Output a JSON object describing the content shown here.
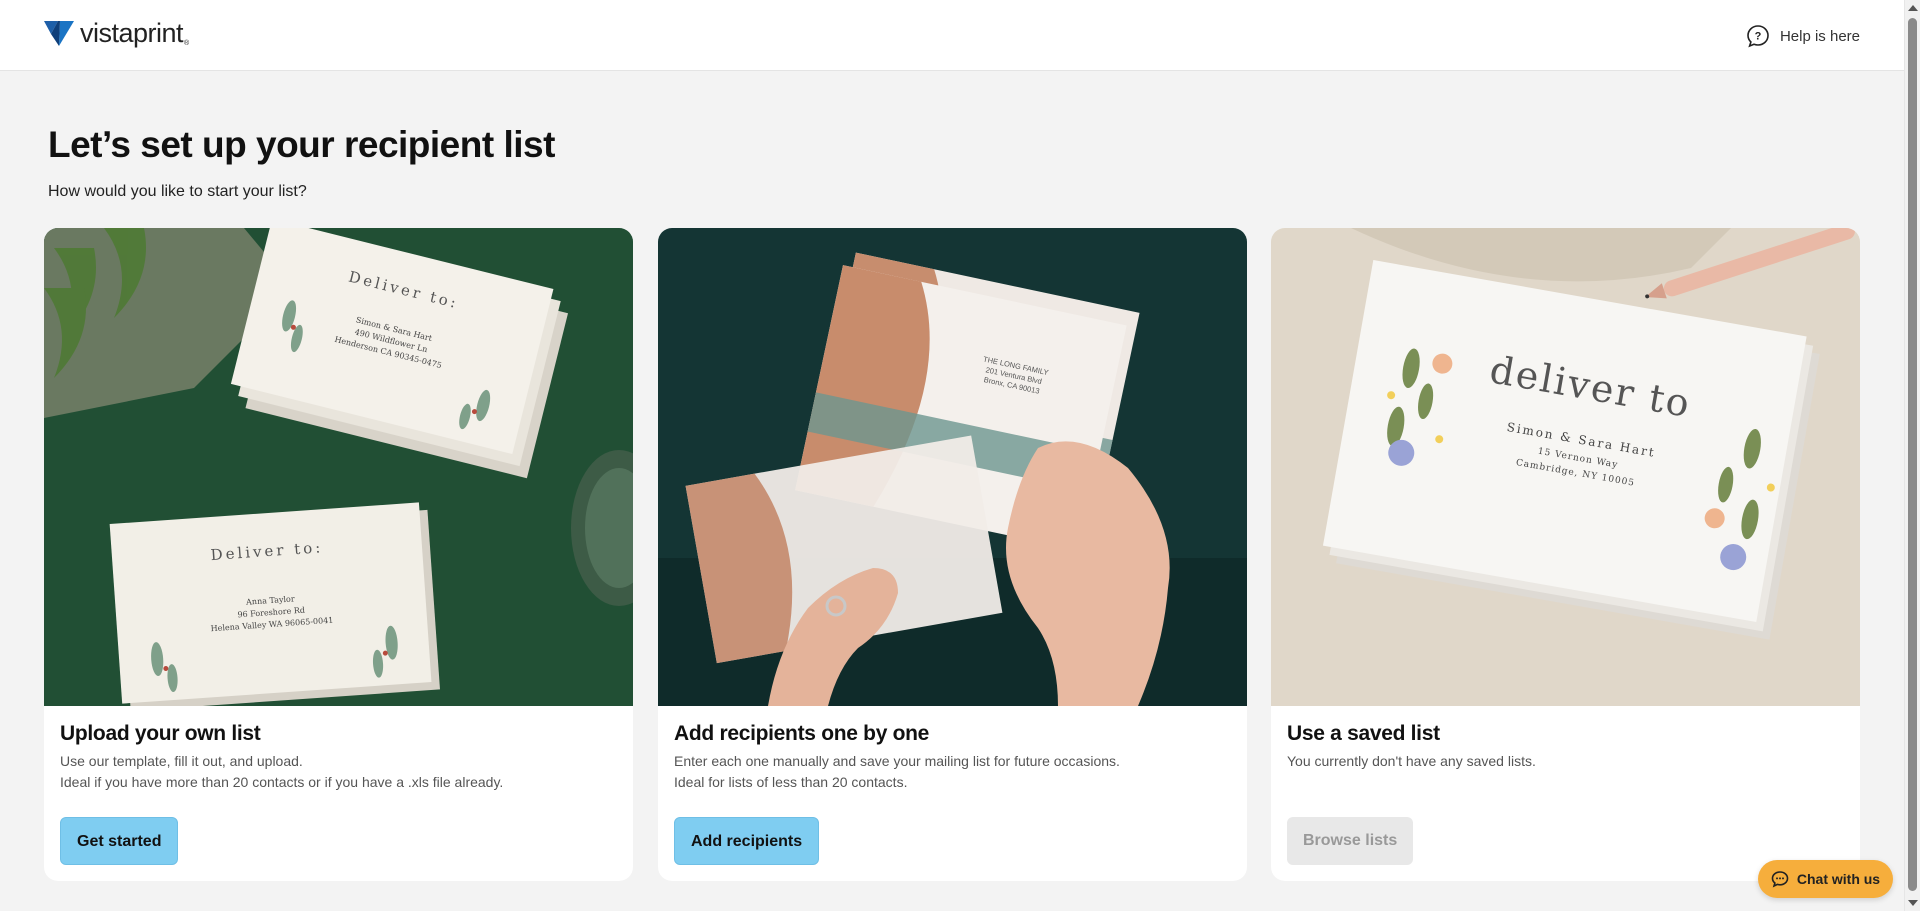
{
  "header": {
    "logo_text": "vistaprint",
    "logo_reg": "®",
    "help_label": "Help is here"
  },
  "main": {
    "title": "Let’s set up your recipient list",
    "subtitle": "How would you like to start your list?"
  },
  "cards": [
    {
      "title": "Upload your own list",
      "desc": [
        "Use our template, fill it out, and upload.",
        "Ideal if you have more than 20 contacts or if you have a .xls file already."
      ],
      "button": "Get started",
      "button_enabled": true,
      "image_text": {
        "env1_heading": "Deliver to:",
        "env1_lines": [
          "Simon & Sara Hart",
          "490 Wildflower Ln",
          "Henderson CA 90345-0475"
        ],
        "env2_heading": "Deliver to:",
        "env2_lines": [
          "Anna Taylor",
          "96 Foreshore Rd",
          "Helena Valley WA 96065-0041"
        ]
      }
    },
    {
      "title": "Add recipients one by one",
      "desc": [
        "Enter each one manually and save your mailing list for future occasions.",
        "Ideal for lists of less than 20 contacts."
      ],
      "button": "Add recipients",
      "button_enabled": true,
      "image_text": {
        "lines": [
          "THE LONG FAMILY",
          "201 Ventura Blvd",
          "Bronx, CA 90013"
        ]
      }
    },
    {
      "title": "Use a saved list",
      "desc": [
        "You currently don't have any saved lists."
      ],
      "button": "Browse lists",
      "button_enabled": false,
      "image_text": {
        "heading": "deliver to",
        "lines": [
          "Simon & Sara Hart",
          "15 Vernon Way",
          "Cambridge, NY 10005"
        ]
      }
    }
  ],
  "chat": {
    "label": "Chat with us"
  },
  "colors": {
    "primary_button": "#7fcdf1",
    "chat_button": "#f6ae3c",
    "page_bg": "#f3f3f3",
    "logo_blue": "#1a74c4"
  }
}
